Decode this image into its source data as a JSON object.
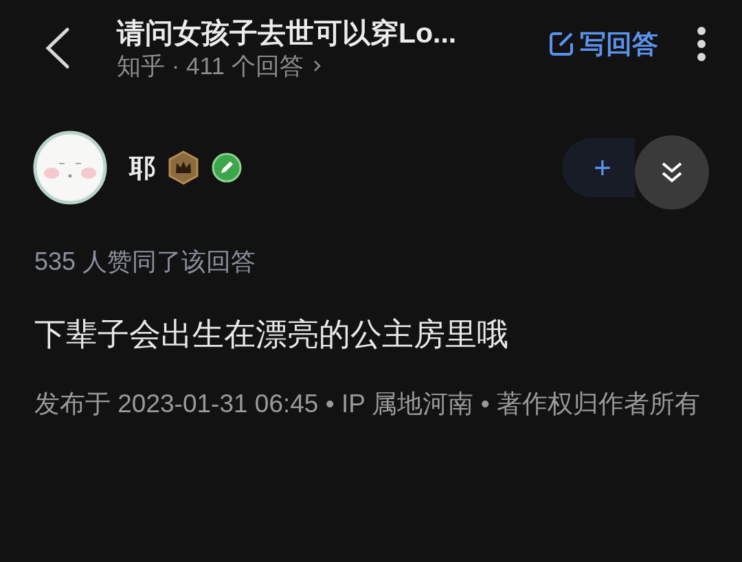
{
  "header": {
    "title": "请问女孩子去世可以穿Lo...",
    "subtitle": "知乎 · 411 个回答",
    "write_answer": "写回答"
  },
  "author": {
    "name": "耶",
    "follow_label": "+"
  },
  "votes": "535 人赞同了该回答",
  "content": "下辈子会出生在漂亮的公主房里哦",
  "footer": "发布于 2023-01-31 06:45 • IP 属地河南 • 著作权归作者所有"
}
